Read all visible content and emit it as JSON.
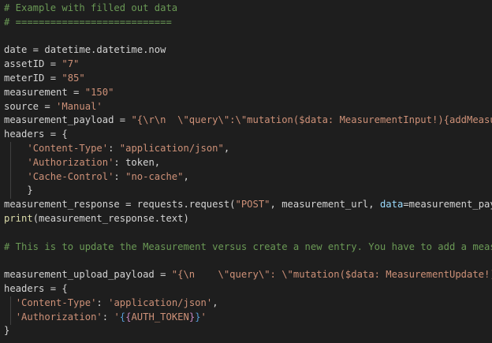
{
  "editor": {
    "lines": [
      [
        {
          "c": "c",
          "t": "# Example with filled out data"
        }
      ],
      [
        {
          "c": "c",
          "t": "# ==========================="
        }
      ],
      [
        {
          "c": "t",
          "t": ""
        }
      ],
      [
        {
          "c": "t",
          "t": "date = datetime.datetime.now"
        }
      ],
      [
        {
          "c": "t",
          "t": "assetID = "
        },
        {
          "c": "s",
          "t": "\"7\""
        }
      ],
      [
        {
          "c": "t",
          "t": "meterID = "
        },
        {
          "c": "s",
          "t": "\"85\""
        }
      ],
      [
        {
          "c": "t",
          "t": "measurement = "
        },
        {
          "c": "s",
          "t": "\"150\""
        }
      ],
      [
        {
          "c": "t",
          "t": "source = "
        },
        {
          "c": "s",
          "t": "'Manual'"
        }
      ],
      [
        {
          "c": "t",
          "t": "measurement_payload = "
        },
        {
          "c": "s",
          "t": "\"{\\r\\n  \\\"query\\\":\\\"mutation($data: MeasurementInput!){addMeasur"
        }
      ],
      [
        {
          "c": "t",
          "t": "headers = {"
        }
      ],
      [
        {
          "c": "t",
          "t": "    "
        },
        {
          "c": "s",
          "t": "'Content-Type'"
        },
        {
          "c": "t",
          "t": ": "
        },
        {
          "c": "s",
          "t": "\"application/json\""
        },
        {
          "c": "t",
          "t": ","
        }
      ],
      [
        {
          "c": "t",
          "t": "    "
        },
        {
          "c": "s",
          "t": "'Authorization'"
        },
        {
          "c": "t",
          "t": ": token,"
        }
      ],
      [
        {
          "c": "t",
          "t": "    "
        },
        {
          "c": "s",
          "t": "'Cache-Control'"
        },
        {
          "c": "t",
          "t": ": "
        },
        {
          "c": "s",
          "t": "\"no-cache\""
        },
        {
          "c": "t",
          "t": ","
        }
      ],
      [
        {
          "c": "t",
          "t": "    }"
        }
      ],
      [
        {
          "c": "t",
          "t": "measurement_response = requests.request("
        },
        {
          "c": "s",
          "t": "\"POST\""
        },
        {
          "c": "t",
          "t": ", measurement_url, "
        },
        {
          "c": "p",
          "t": "data"
        },
        {
          "c": "t",
          "t": "=measurement_payl"
        }
      ],
      [
        {
          "c": "k",
          "t": "print"
        },
        {
          "c": "t",
          "t": "(measurement_response.text)"
        }
      ],
      [
        {
          "c": "t",
          "t": ""
        }
      ],
      [
        {
          "c": "c",
          "t": "# This is to update the Measurement versus create a new entry. You have to add a measu"
        }
      ],
      [
        {
          "c": "t",
          "t": ""
        }
      ],
      [
        {
          "c": "t",
          "t": "measurement_upload_payload = "
        },
        {
          "c": "s",
          "t": "\"{\\n    \\\"query\\\": \\\"mutation($data: MeasurementUpdate!){"
        }
      ],
      [
        {
          "c": "t",
          "t": "headers = {"
        }
      ],
      [
        {
          "c": "t",
          "t": "  "
        },
        {
          "c": "s",
          "t": "'Content-Type'"
        },
        {
          "c": "t",
          "t": ": "
        },
        {
          "c": "s",
          "t": "'application/json'"
        },
        {
          "c": "t",
          "t": ","
        }
      ],
      [
        {
          "c": "t",
          "t": "  "
        },
        {
          "c": "s",
          "t": "'Authorization'"
        },
        {
          "c": "t",
          "t": ": "
        },
        {
          "c": "s",
          "t": "'"
        },
        {
          "c": "bl",
          "t": "{"
        },
        {
          "c": "bi",
          "t": "{"
        },
        {
          "c": "s",
          "t": "AUTH_TOKEN"
        },
        {
          "c": "bi",
          "t": "}"
        },
        {
          "c": "bl",
          "t": "}"
        },
        {
          "c": "s",
          "t": "'"
        }
      ],
      [
        {
          "c": "t",
          "t": "}"
        }
      ]
    ]
  }
}
